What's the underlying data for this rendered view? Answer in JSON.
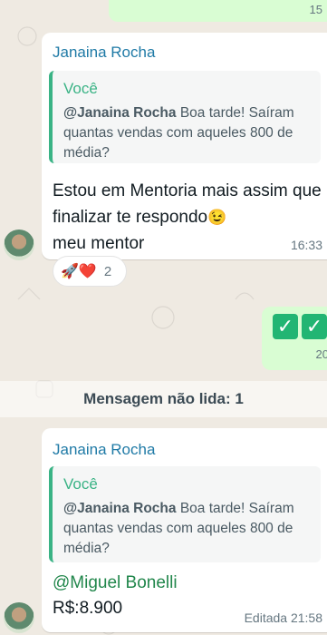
{
  "top_outgoing": {
    "time": "15"
  },
  "message1": {
    "sender": "Janaina Rocha",
    "quote_name": "Você",
    "quote_mention": "@Janaina Rocha",
    "quote_text": " Boa tarde! Saíram quantas vendas com aqueles 800 de média?",
    "text": "Estou em Mentoria  mais assim que finalizar te respondo",
    "text_tail": "meu mentor",
    "time": "16:33",
    "reactions": {
      "emojis": "🚀❤️",
      "count": "2"
    }
  },
  "outgoing_checks": {
    "emoji": "✓",
    "time": "20"
  },
  "unread_divider": "Mensagem não lida: 1",
  "message2": {
    "sender": "Janaina Rocha",
    "quote_name": "Você",
    "quote_mention": "@Janaina Rocha",
    "quote_text": " Boa tarde! Saíram quantas vendas com aqueles 800 de média?",
    "mention": "@Miguel Bonelli",
    "price": "R$:8.900",
    "edited_time": "Editada  21:58"
  },
  "colors": {
    "incoming": "#ffffff",
    "outgoing": "#d9fdd3",
    "background": "#efeae2",
    "accent_green": "#3ab385",
    "sender_blue": "#1f7aa6"
  }
}
